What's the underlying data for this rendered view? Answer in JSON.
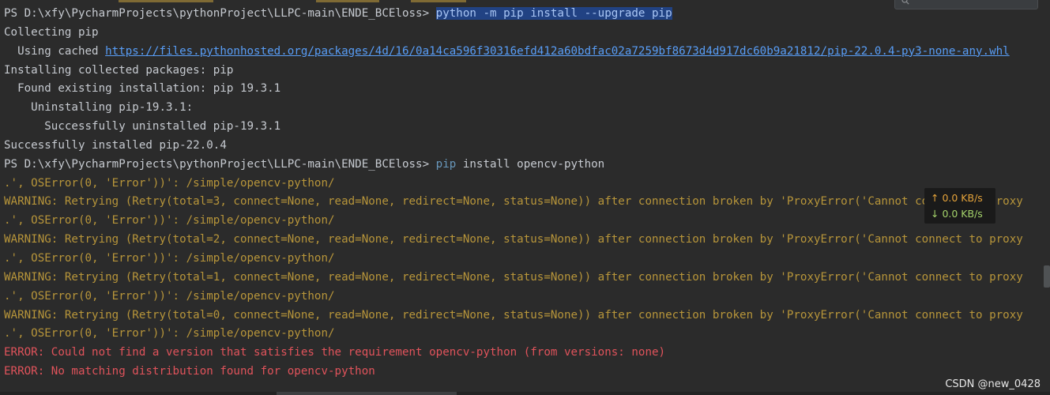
{
  "colors": {
    "background": "#2b2b2b",
    "text": "#c6cad0",
    "highlight_bg": "#214283",
    "command": "#6897bb",
    "link": "#589df6",
    "warning": "#b7953a",
    "error": "#e0535b"
  },
  "search": {
    "icon": "search-icon"
  },
  "terminal": {
    "prompt1": "PS D:\\xfy\\PycharmProjects\\pythonProject\\LLPC-main\\ENDE_BCEloss> ",
    "cmd1": "python -m pip install --upgrade pip",
    "collecting": "Collecting pip",
    "using_cached_prefix": "  Using cached ",
    "using_cached_url": "https://files.pythonhosted.org/packages/4d/16/0a14ca596f30316efd412a60bdfac02a7259bf8673d4d917dc60b9a21812/pip-22.0.4-py3-none-any.whl",
    "installing_collected": "Installing collected packages: pip",
    "found_existing": "  Found existing installation: pip 19.3.1",
    "uninstalling": "    Uninstalling pip-19.3.1:",
    "uninstalled": "      Successfully uninstalled pip-19.3.1",
    "installed": "Successfully installed pip-22.0.4",
    "prompt2": "PS D:\\xfy\\PycharmProjects\\pythonProject\\LLPC-main\\ENDE_BCEloss> ",
    "cmd2_keyword": "pip",
    "cmd2_rest": " install opencv-python",
    "oserror_line": ".', OSError(0, 'Error'))': /simple/opencv-python/",
    "warn_total3": "WARNING: Retrying (Retry(total=3, connect=None, read=None, redirect=None, status=None)) after connection broken by 'ProxyError('Cannot connect to proxy",
    "warn_total2": "WARNING: Retrying (Retry(total=2, connect=None, read=None, redirect=None, status=None)) after connection broken by 'ProxyError('Cannot connect to proxy",
    "warn_total1": "WARNING: Retrying (Retry(total=1, connect=None, read=None, redirect=None, status=None)) after connection broken by 'ProxyError('Cannot connect to proxy",
    "warn_total0": "WARNING: Retrying (Retry(total=0, connect=None, read=None, redirect=None, status=None)) after connection broken by 'ProxyError('Cannot connect to proxy",
    "error1": "ERROR: Could not find a version that satisfies the requirement opencv-python (from versions: none)",
    "error2": "ERROR: No matching distribution found for opencv-python"
  },
  "net_speed": {
    "up": "↑ 0.0 KB/s",
    "down": "↓ 0.0 KB/s"
  },
  "watermark": "CSDN @new_0428"
}
